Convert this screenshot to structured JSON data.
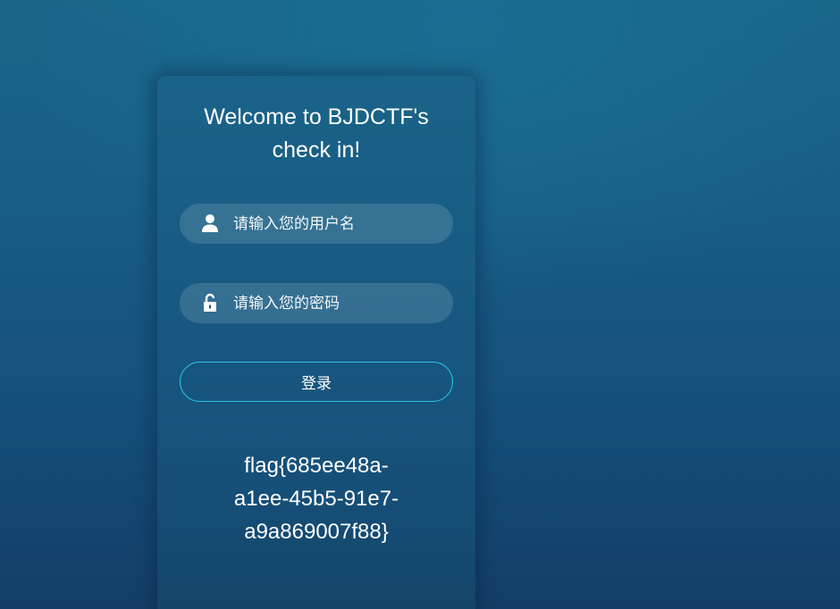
{
  "login_card": {
    "welcome_line1": "Welcome to BJDCTF's",
    "welcome_line2": "check in!",
    "username": {
      "placeholder": "请输入您的用户名",
      "value": "",
      "icon": "user-icon"
    },
    "password": {
      "placeholder": "请输入您的密码",
      "value": "",
      "icon": "unlocked-lock-icon"
    },
    "login_label": "登录",
    "flag_lines": [
      "flag{685ee48a-",
      "a1ee-45b5-91e7-",
      "a9a869007f88}"
    ]
  },
  "colors": {
    "button_border": "#29c3e8",
    "background_top": "#1a6689",
    "background_bottom": "#123e67"
  }
}
